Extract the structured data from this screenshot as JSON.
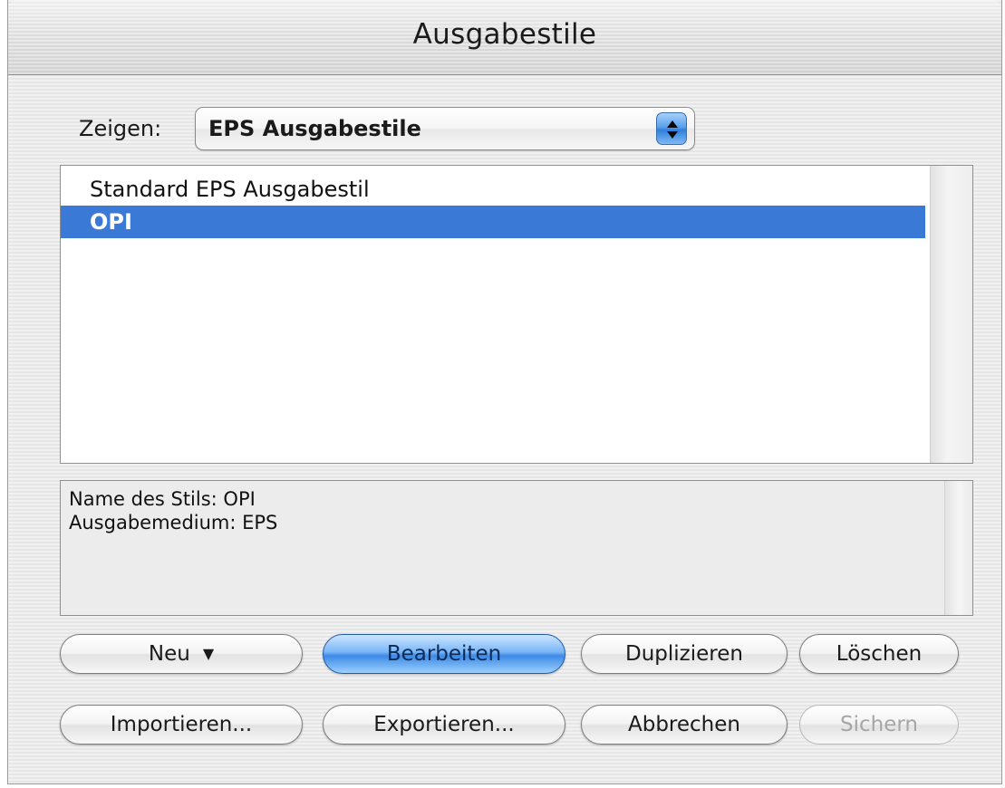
{
  "window": {
    "title": "Ausgabestile"
  },
  "filter": {
    "label": "Zeigen:",
    "selected": "EPS Ausgabestile"
  },
  "styles_list": {
    "items": [
      {
        "label": "Standard EPS Ausgabestil",
        "selected": false
      },
      {
        "label": "OPI",
        "selected": true
      }
    ]
  },
  "details": {
    "lines": [
      "Name des Stils: OPI",
      "Ausgabemedium: EPS"
    ]
  },
  "buttons": {
    "new": "Neu",
    "edit": "Bearbeiten",
    "duplicate": "Duplizieren",
    "delete": "Löschen",
    "import": "Importieren...",
    "export": "Exportieren...",
    "cancel": "Abbrechen",
    "save": "Sichern"
  },
  "colors": {
    "selection": "#3b79d6",
    "default_button": "#3c8ae6"
  },
  "icons": {
    "popup": "updown-arrows-icon",
    "new_menu": "triangle-down-icon"
  }
}
